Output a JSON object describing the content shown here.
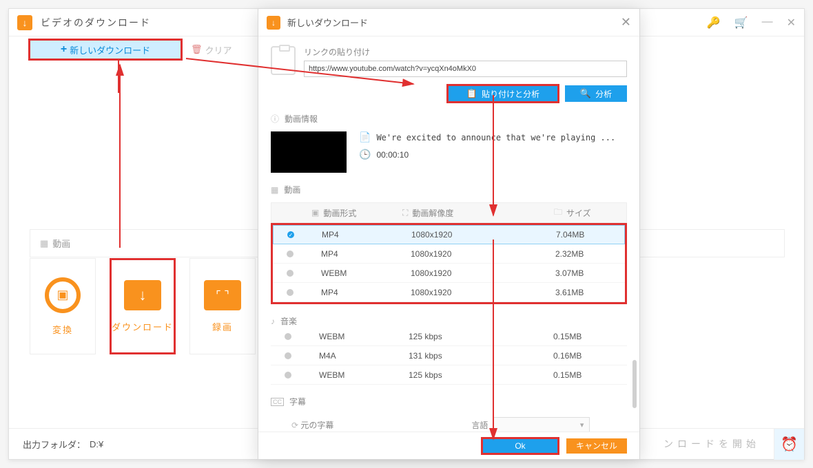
{
  "main": {
    "title": "ビデオのダウンロード",
    "new_download": "新しいダウンロード",
    "clear": "クリア",
    "category_label": "動画",
    "tiles": {
      "convert": "変換",
      "download": "ダウンロード",
      "record": "録画"
    },
    "footer": {
      "output_label": "出力フォルダ：",
      "output_path": "D:¥",
      "start_download": "ンロードを開始"
    }
  },
  "dialog": {
    "title": "新しいダウンロード",
    "paste_label": "リンクの貼り付け",
    "url": "https://www.youtube.com/watch?v=ycqXn4oMkX0",
    "paste_analyze": "貼り付けと分析",
    "analyze": "分析",
    "video_info_label": "動画情報",
    "video_title": "We're excited to announce that we're playing ...",
    "video_duration": "00:00:10",
    "video_section": "動画",
    "columns": {
      "format": "動画形式",
      "resolution": "動画解像度",
      "size": "サイズ"
    },
    "video_formats": [
      {
        "selected": true,
        "format": "MP4",
        "resolution": "1080x1920",
        "size": "7.04MB"
      },
      {
        "selected": false,
        "format": "MP4",
        "resolution": "1080x1920",
        "size": "2.32MB"
      },
      {
        "selected": false,
        "format": "WEBM",
        "resolution": "1080x1920",
        "size": "3.07MB"
      },
      {
        "selected": false,
        "format": "MP4",
        "resolution": "1080x1920",
        "size": "3.61MB"
      }
    ],
    "music_section": "音楽",
    "audio_formats": [
      {
        "selected": false,
        "format": "WEBM",
        "resolution": "125 kbps",
        "size": "0.15MB"
      },
      {
        "selected": false,
        "format": "M4A",
        "resolution": "131 kbps",
        "size": "0.16MB"
      },
      {
        "selected": false,
        "format": "WEBM",
        "resolution": "125 kbps",
        "size": "0.15MB"
      }
    ],
    "subtitle_section": "字幕",
    "original_subtitle": "元の字幕",
    "language_label": "言語",
    "ok": "Ok",
    "cancel": "キャンセル"
  }
}
